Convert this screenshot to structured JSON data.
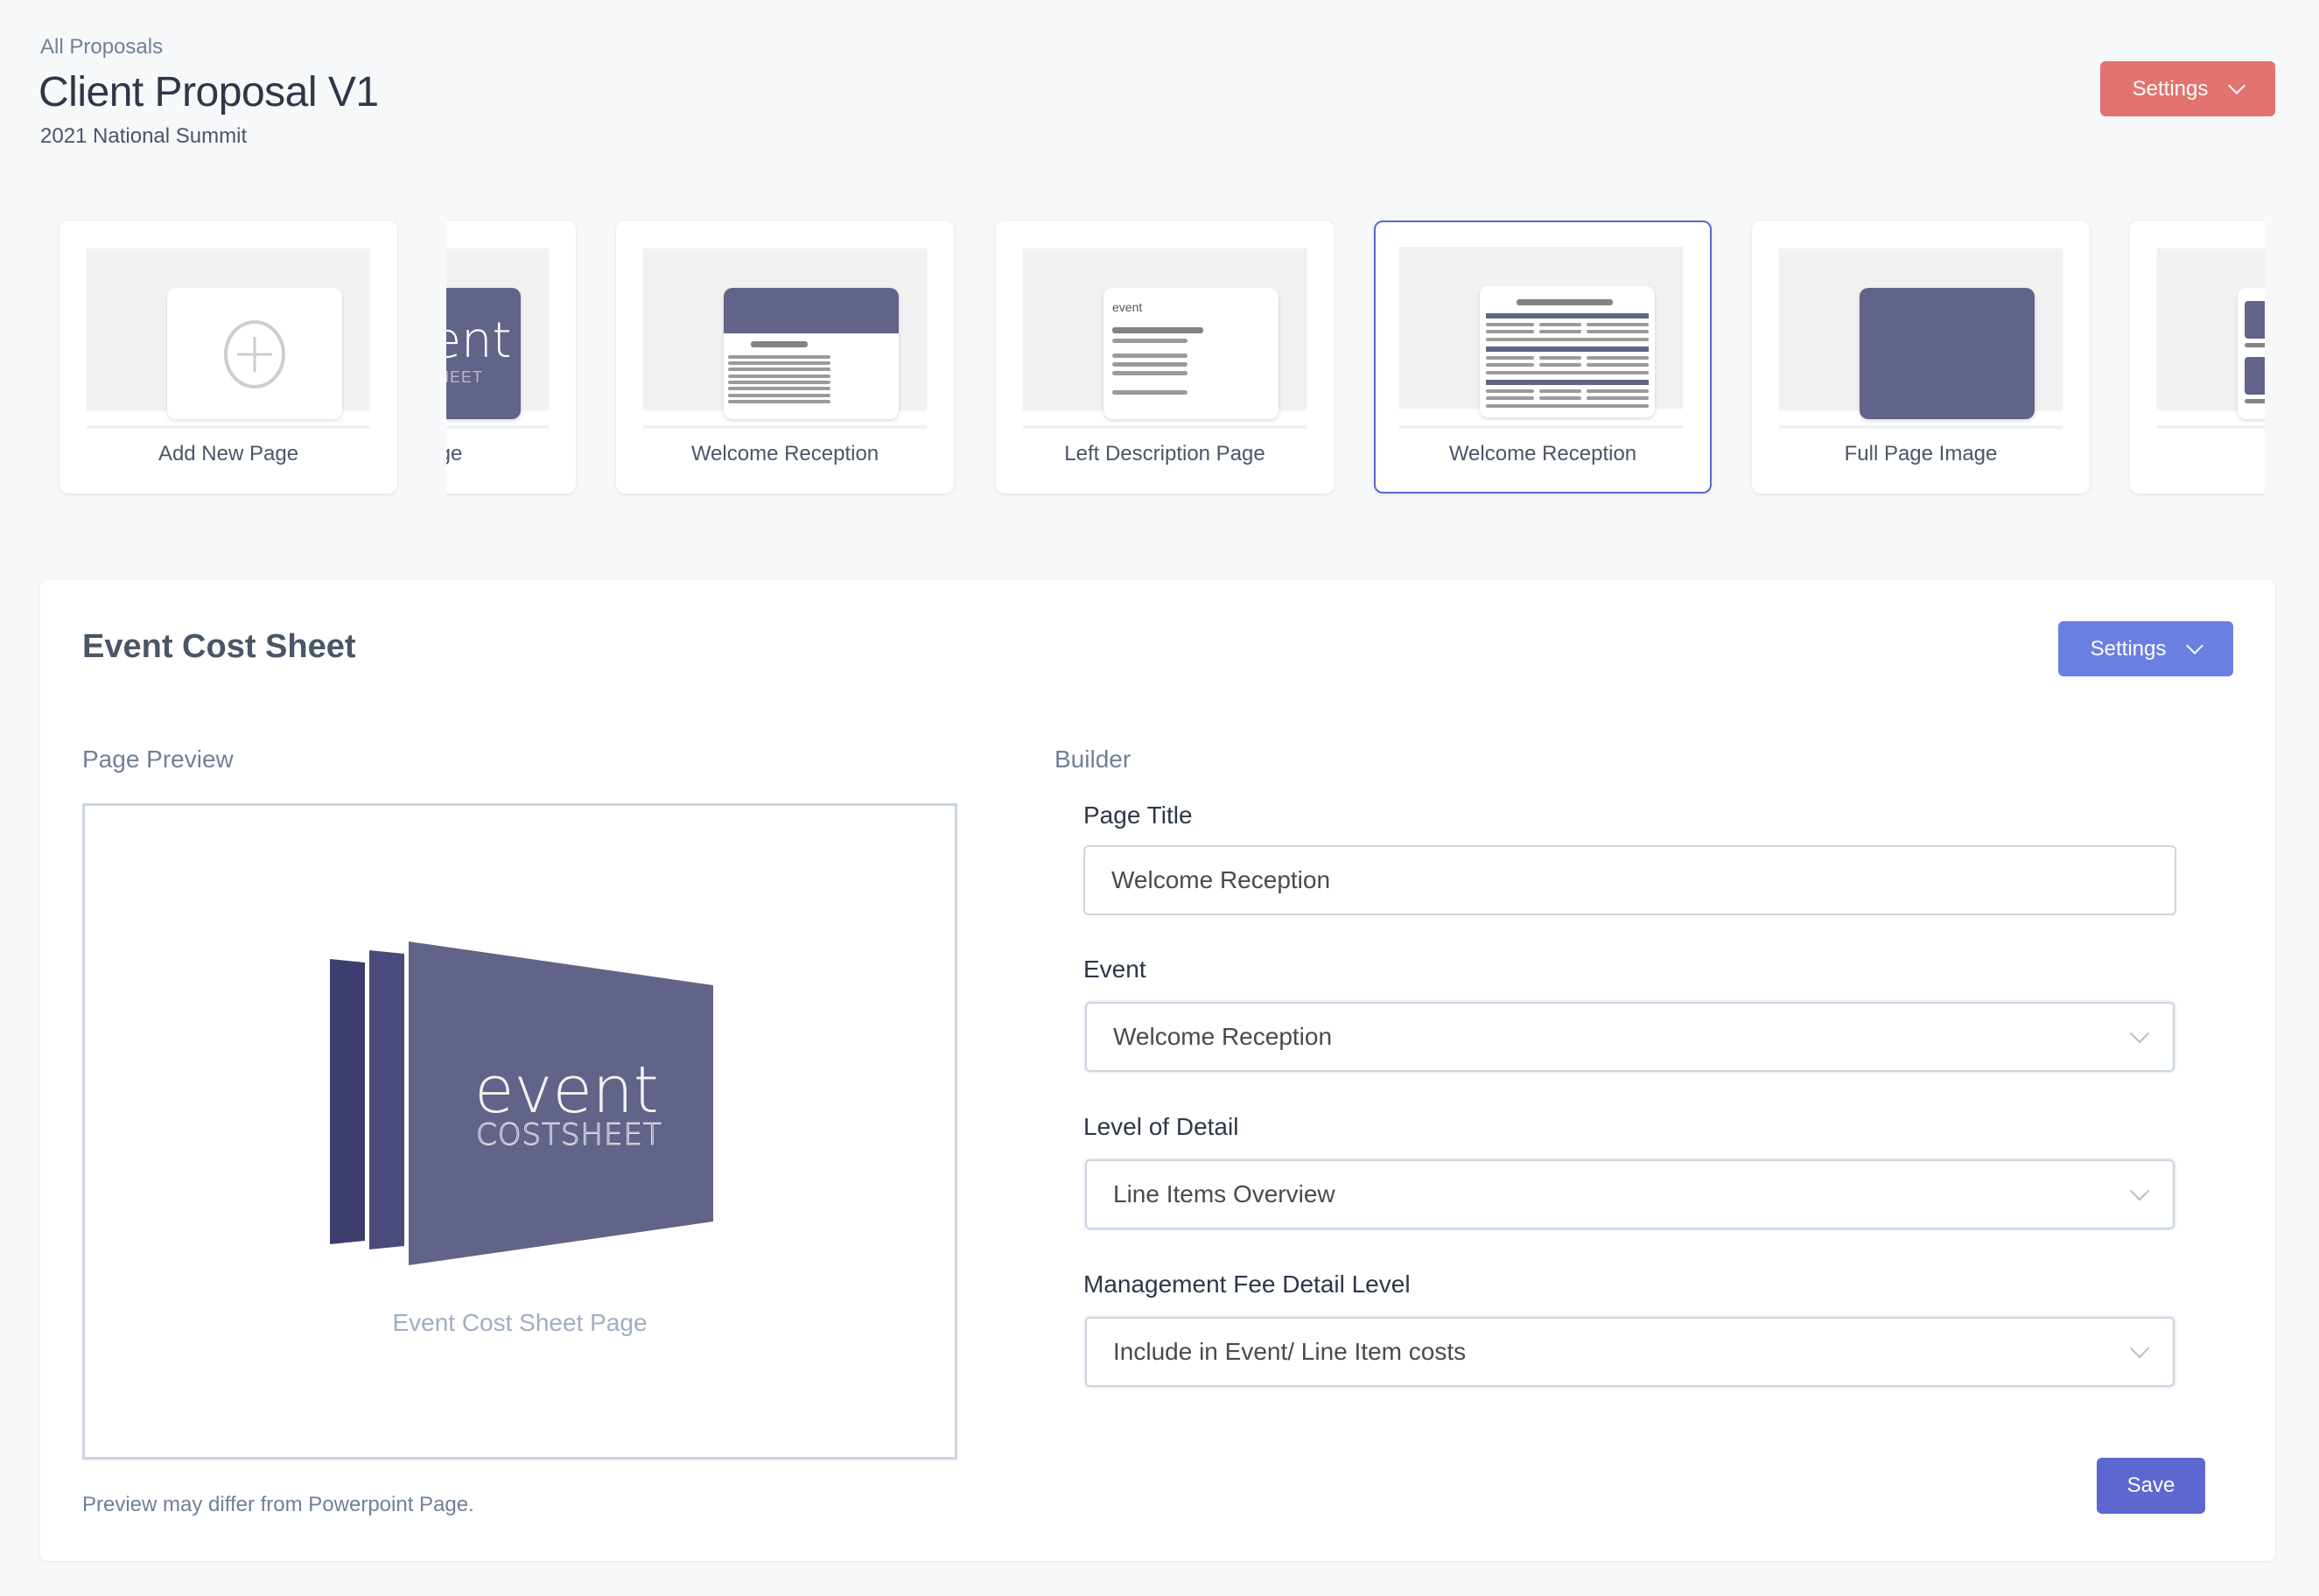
{
  "header": {
    "breadcrumb": "All Proposals",
    "title": "Client Proposal V1",
    "subtitle": "2021 National Summit",
    "settings_label": "Settings",
    "settings_color": "#E2736F"
  },
  "add_page_card": {
    "label": "Add New Page",
    "icon": "plus-circle-icon"
  },
  "page_cards": [
    {
      "label": "Cover Page",
      "visible_label": "er Page",
      "thumbnail": "logo-cover"
    },
    {
      "label": "Welcome Reception",
      "thumbnail": "header-text"
    },
    {
      "label": "Left Description Page",
      "thumbnail": "left-description"
    },
    {
      "label": "Welcome Reception",
      "thumbnail": "cost-table",
      "selected": true
    },
    {
      "label": "Full Page Image",
      "thumbnail": "full-image"
    },
    {
      "label": "",
      "thumbnail": "image-list"
    }
  ],
  "panel": {
    "title": "Event Cost Sheet",
    "settings_label": "Settings",
    "settings_color": "#6B7FE2",
    "preview": {
      "label": "Page Preview",
      "logo_word": "event",
      "logo_sub": "COSTSHEET",
      "caption": "Event Cost Sheet Page",
      "note": "Preview may differ from Powerpoint Page."
    },
    "builder": {
      "label": "Builder",
      "fields": {
        "page_title": {
          "label": "Page Title",
          "value": "Welcome Reception"
        },
        "event": {
          "label": "Event",
          "value": "Welcome Reception"
        },
        "level_of_detail": {
          "label": "Level of Detail",
          "value": "Line Items Overview"
        },
        "management_fee": {
          "label": "Management Fee Detail Level",
          "value": "Include in Event/ Line Item costs"
        }
      },
      "save_label": "Save",
      "save_color": "#5C67D0"
    }
  },
  "colors": {
    "brand_purple": "#626388",
    "selected_border": "#5C67D0"
  }
}
